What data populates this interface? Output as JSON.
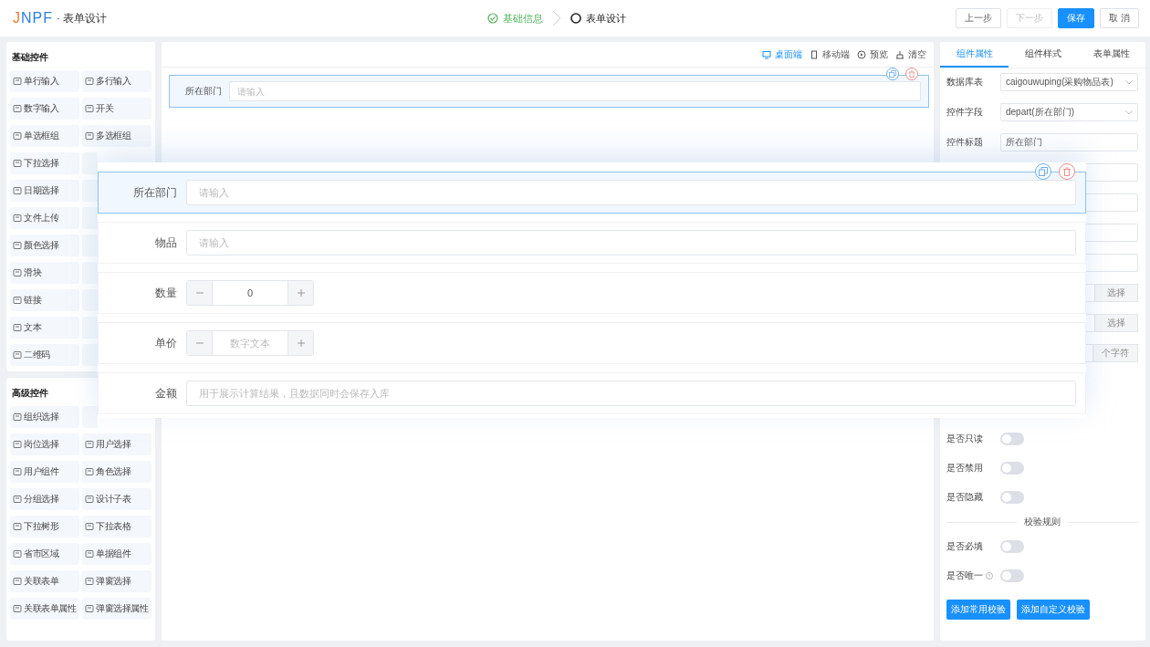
{
  "header": {
    "logo": "JNPF",
    "title": "· 表单设计",
    "steps": [
      {
        "label": "基础信息",
        "done": true
      },
      {
        "label": "表单设计",
        "done": false
      }
    ],
    "buttons": [
      {
        "label": "上一步",
        "kind": "default",
        "disabled": false
      },
      {
        "label": "下一步",
        "kind": "default",
        "disabled": true
      },
      {
        "label": "保存",
        "kind": "primary",
        "disabled": false
      },
      {
        "label": "取 消",
        "kind": "default",
        "disabled": false
      }
    ]
  },
  "palette": [
    {
      "title": "基础控件",
      "items": [
        {
          "kind": "control",
          "label": "单行输入"
        },
        {
          "kind": "control",
          "label": "多行输入"
        },
        {
          "kind": "control",
          "label": "数字输入"
        },
        {
          "kind": "control",
          "label": "开关"
        },
        {
          "kind": "control",
          "label": "单选框组"
        },
        {
          "kind": "control",
          "label": "多选框组"
        },
        {
          "kind": "control",
          "label": "下拉选择"
        },
        {
          "kind": "covered"
        },
        {
          "kind": "control",
          "label": "日期选择"
        },
        {
          "kind": "covered"
        },
        {
          "kind": "control",
          "label": "文件上传"
        },
        {
          "kind": "covered"
        },
        {
          "kind": "control",
          "label": "颜色选择"
        },
        {
          "kind": "covered"
        },
        {
          "kind": "control",
          "label": "滑块"
        },
        {
          "kind": "covered"
        },
        {
          "kind": "control",
          "label": "链接"
        },
        {
          "kind": "covered"
        },
        {
          "kind": "control",
          "label": "文本"
        },
        {
          "kind": "covered"
        },
        {
          "kind": "control",
          "label": "二维码"
        },
        {
          "kind": "covered"
        }
      ]
    },
    {
      "title": "高级控件",
      "items": [
        {
          "kind": "control",
          "label": "组织选择"
        },
        {
          "kind": "covered"
        },
        {
          "kind": "control",
          "label": "岗位选择"
        },
        {
          "kind": "control",
          "label": "用户选择"
        },
        {
          "kind": "control",
          "label": "用户组件"
        },
        {
          "kind": "control",
          "label": "角色选择"
        },
        {
          "kind": "control",
          "label": "分组选择"
        },
        {
          "kind": "control",
          "label": "设计子表"
        },
        {
          "kind": "control",
          "label": "下拉树形"
        },
        {
          "kind": "control",
          "label": "下拉表格"
        },
        {
          "kind": "control",
          "label": "省市区域"
        },
        {
          "kind": "control",
          "label": "单据组件"
        },
        {
          "kind": "control",
          "label": "关联表单"
        },
        {
          "kind": "control",
          "label": "弹窗选择"
        },
        {
          "kind": "control",
          "label": "关联表单属性"
        },
        {
          "kind": "control",
          "label": "弹窗选择属性"
        }
      ]
    }
  ],
  "canvas": {
    "toolbar": [
      {
        "label": "桌面端",
        "selected": true
      },
      {
        "label": "移动端",
        "selected": false
      },
      {
        "label": "预览",
        "selected": false
      },
      {
        "label": "清空",
        "selected": false
      }
    ],
    "fields": [
      {
        "label": "所在部门",
        "placeholder": "请输入",
        "selected": true
      }
    ]
  },
  "zoom": {
    "fields": [
      {
        "kind": "input",
        "label": "所在部门",
        "placeholder": "请输入",
        "selected": true
      },
      {
        "kind": "input",
        "label": "物品",
        "placeholder": "请输入",
        "selected": false
      },
      {
        "kind": "number",
        "label": "数量",
        "value": "0",
        "selected": false
      },
      {
        "kind": "number",
        "label": "单价",
        "placeholder": "数字文本",
        "selected": false
      },
      {
        "kind": "input",
        "label": "金额",
        "placeholder": "用于展示计算结果，且数据同时会保存入库",
        "selected": false
      }
    ]
  },
  "properties": {
    "tabs": [
      {
        "label": "组件属性",
        "selected": true
      },
      {
        "label": "组件样式",
        "selected": false
      },
      {
        "label": "表单属性",
        "selected": false
      }
    ],
    "rows": [
      {
        "kind": "select",
        "label": "数据库表",
        "value": "caigouwuping(采购物品表)"
      },
      {
        "kind": "select",
        "label": "控件字段",
        "value": "depart(所在部门)"
      },
      {
        "kind": "input",
        "label": "控件标题",
        "value": "所在部门"
      },
      {
        "kind": "blank"
      },
      {
        "kind": "blank"
      },
      {
        "kind": "blank"
      },
      {
        "kind": "blank"
      },
      {
        "kind": "pick",
        "button": "选择"
      },
      {
        "kind": "pick",
        "button": "选择"
      },
      {
        "kind": "suffix",
        "suffix": "个字符"
      }
    ],
    "switches": [
      {
        "label": "是否只读",
        "on": false
      },
      {
        "label": "是否禁用",
        "on": false
      },
      {
        "label": "是否隐藏",
        "on": false
      }
    ],
    "divider": "校验规则",
    "rules": [
      {
        "label": "是否必填",
        "on": false,
        "info": false
      },
      {
        "label": "是否唯一",
        "on": false,
        "info": true
      }
    ],
    "buttons": [
      "添加常用校验",
      "添加自定义校验"
    ]
  }
}
